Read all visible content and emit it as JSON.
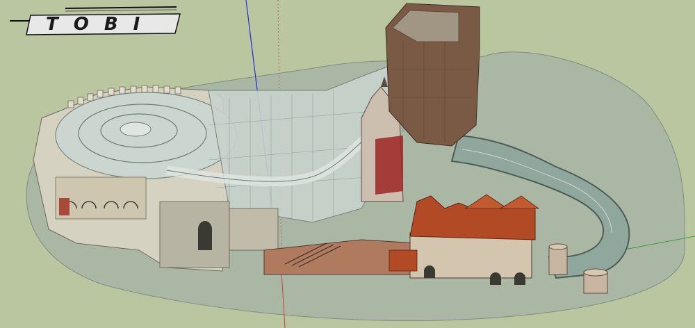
{
  "logo": {
    "text": "TOBI"
  },
  "scene": {
    "description_type": "3d-model-viewport",
    "colors": {
      "background": "#b9c6a0",
      "ground": "#a9b7a4",
      "stone_wall": "#d6d2c2",
      "glass": "#c9d7d2",
      "water": "#8fa79c",
      "roof_tiles": "#b24a26",
      "tower_rock": "#7a5a45",
      "red_accent": "#9c2424",
      "axis_blue": "#2b2bd0",
      "axis_red": "#c84040",
      "axis_green": "#3fa040"
    }
  }
}
